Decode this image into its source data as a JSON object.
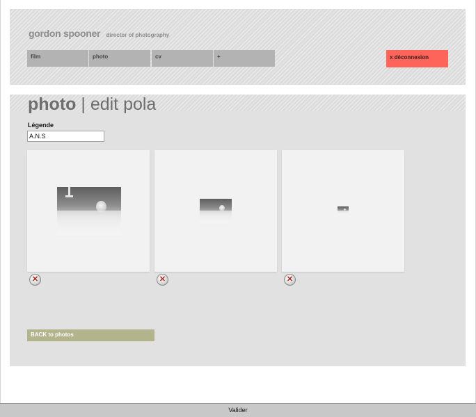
{
  "header": {
    "brand_name": "gordon spooner",
    "brand_subtitle": "director of photography",
    "nav": [
      "film",
      "photo",
      "cv",
      "+"
    ],
    "logout_label": "x déconnexion"
  },
  "page": {
    "title_section": "photo",
    "title_separator": " | ",
    "title_action": "edit pola"
  },
  "form": {
    "legend_label": "Légende",
    "legend_value": "A.N.S"
  },
  "photos": [
    {
      "size": "large"
    },
    {
      "size": "medium"
    },
    {
      "size": "small"
    }
  ],
  "back_label": "BACK to photos",
  "submit_label": "Valider",
  "colors": {
    "accent_logout": "#ff645a",
    "back_button": "#b2b48c",
    "nav_button": "#b3b3b3",
    "panel_background": "#e1e1e1"
  }
}
